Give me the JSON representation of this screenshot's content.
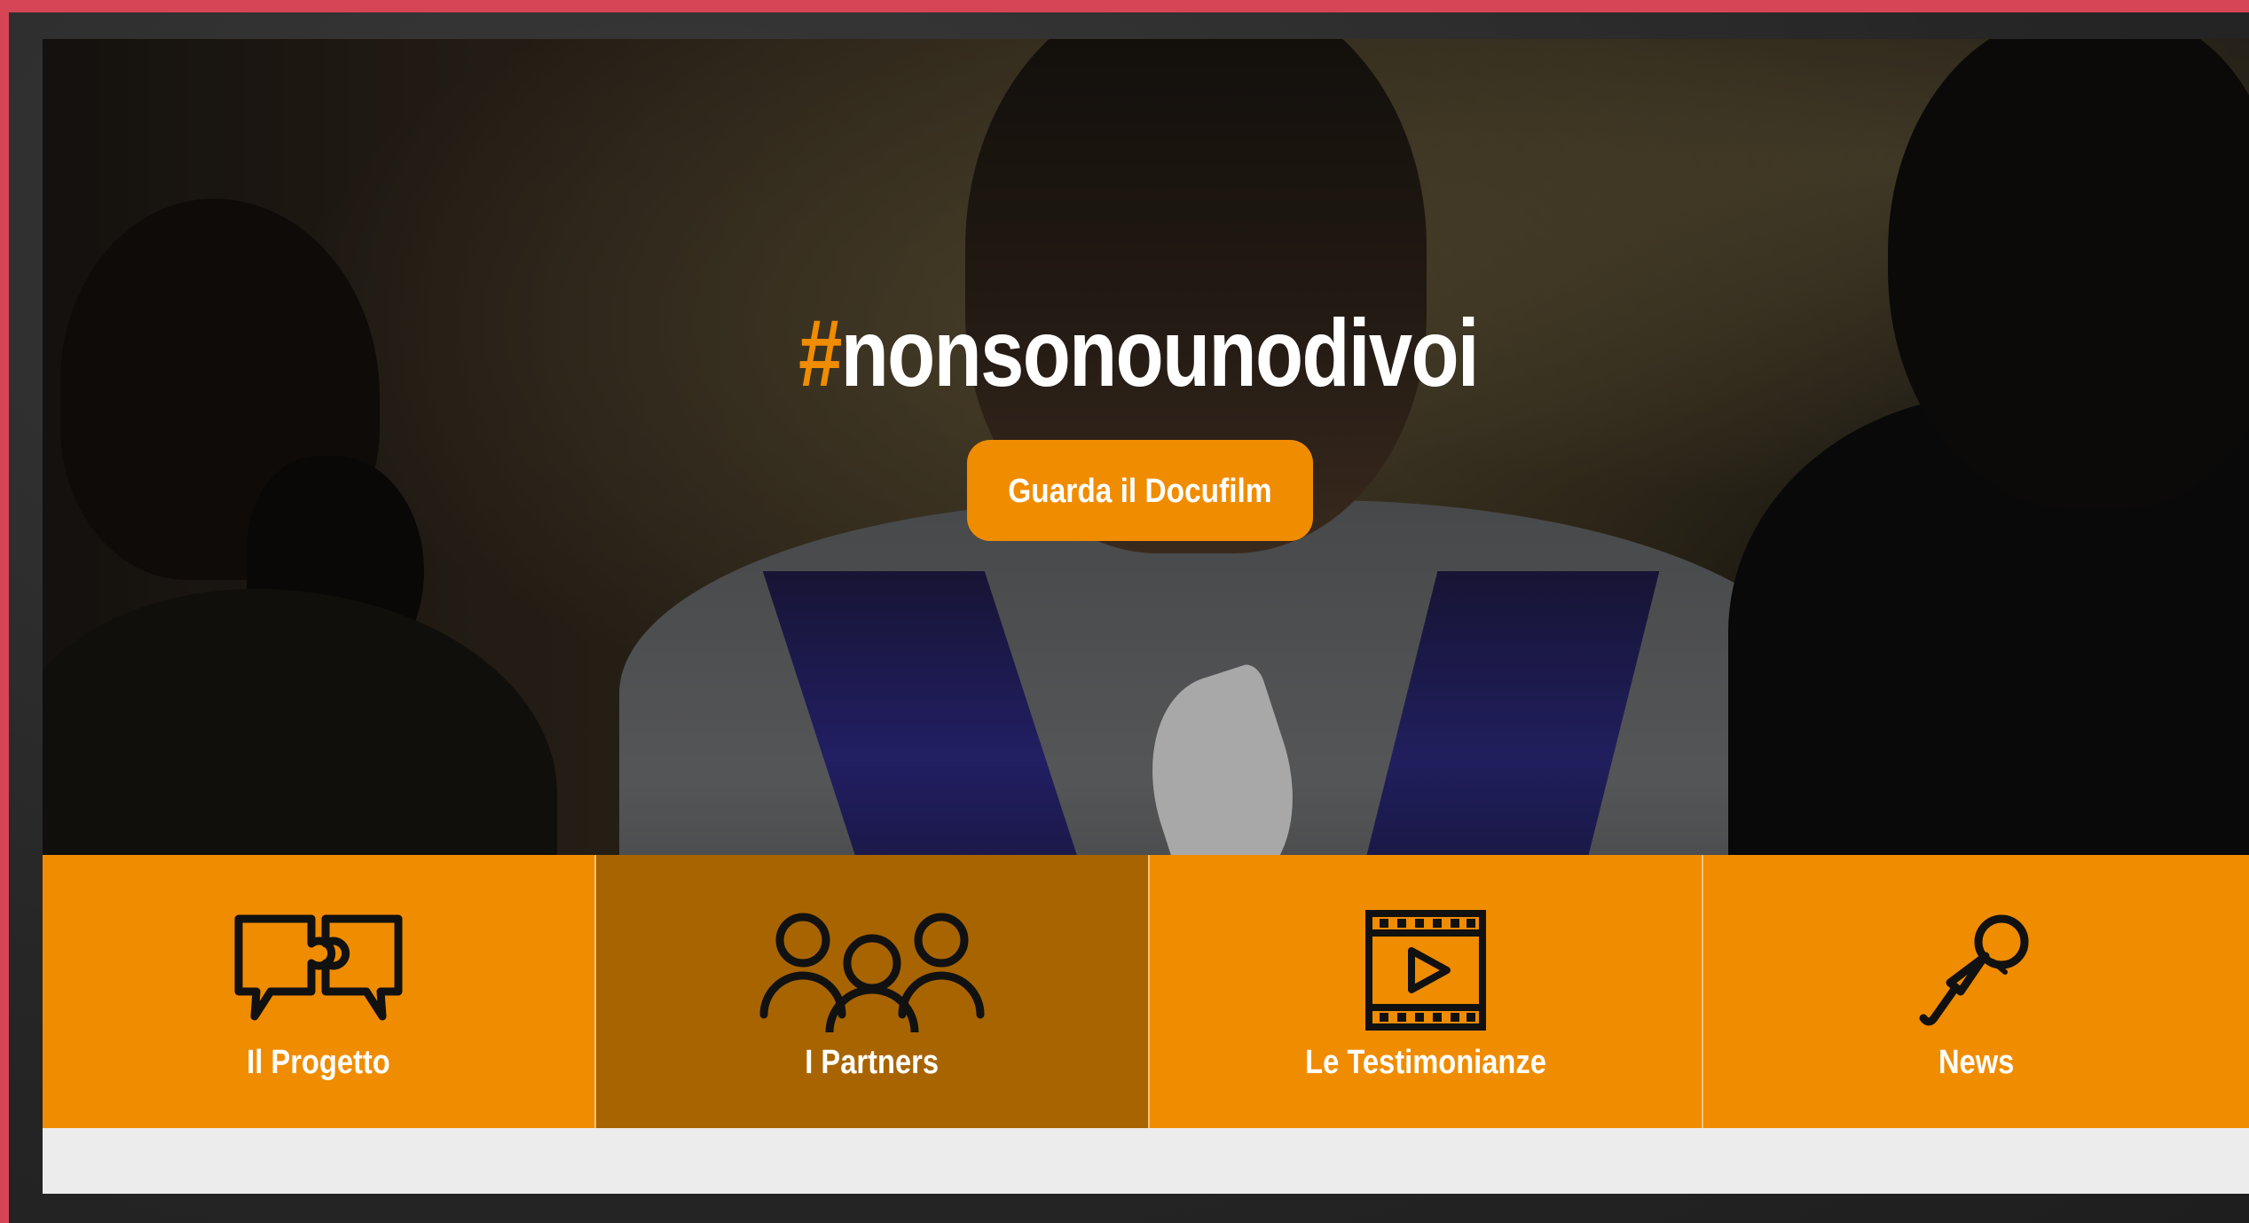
{
  "hero": {
    "hashtag_symbol": "#",
    "hashtag_text": "nonsonounodivoi",
    "cta_label": "Guarda il Docufilm"
  },
  "tiles": [
    {
      "label": "Il Progetto",
      "icon": "puzzle-speech-bubbles-icon",
      "active": false
    },
    {
      "label": "I Partners",
      "icon": "people-group-icon",
      "active": true
    },
    {
      "label": "Le Testimonianze",
      "icon": "film-play-icon",
      "active": false
    },
    {
      "label": "News",
      "icon": "microphone-icon",
      "active": false
    }
  ],
  "colors": {
    "accent": "#f08c00",
    "accent_active": "#a76400",
    "frame_border": "#d64555",
    "text": "#ffffff",
    "icon": "#111111"
  }
}
